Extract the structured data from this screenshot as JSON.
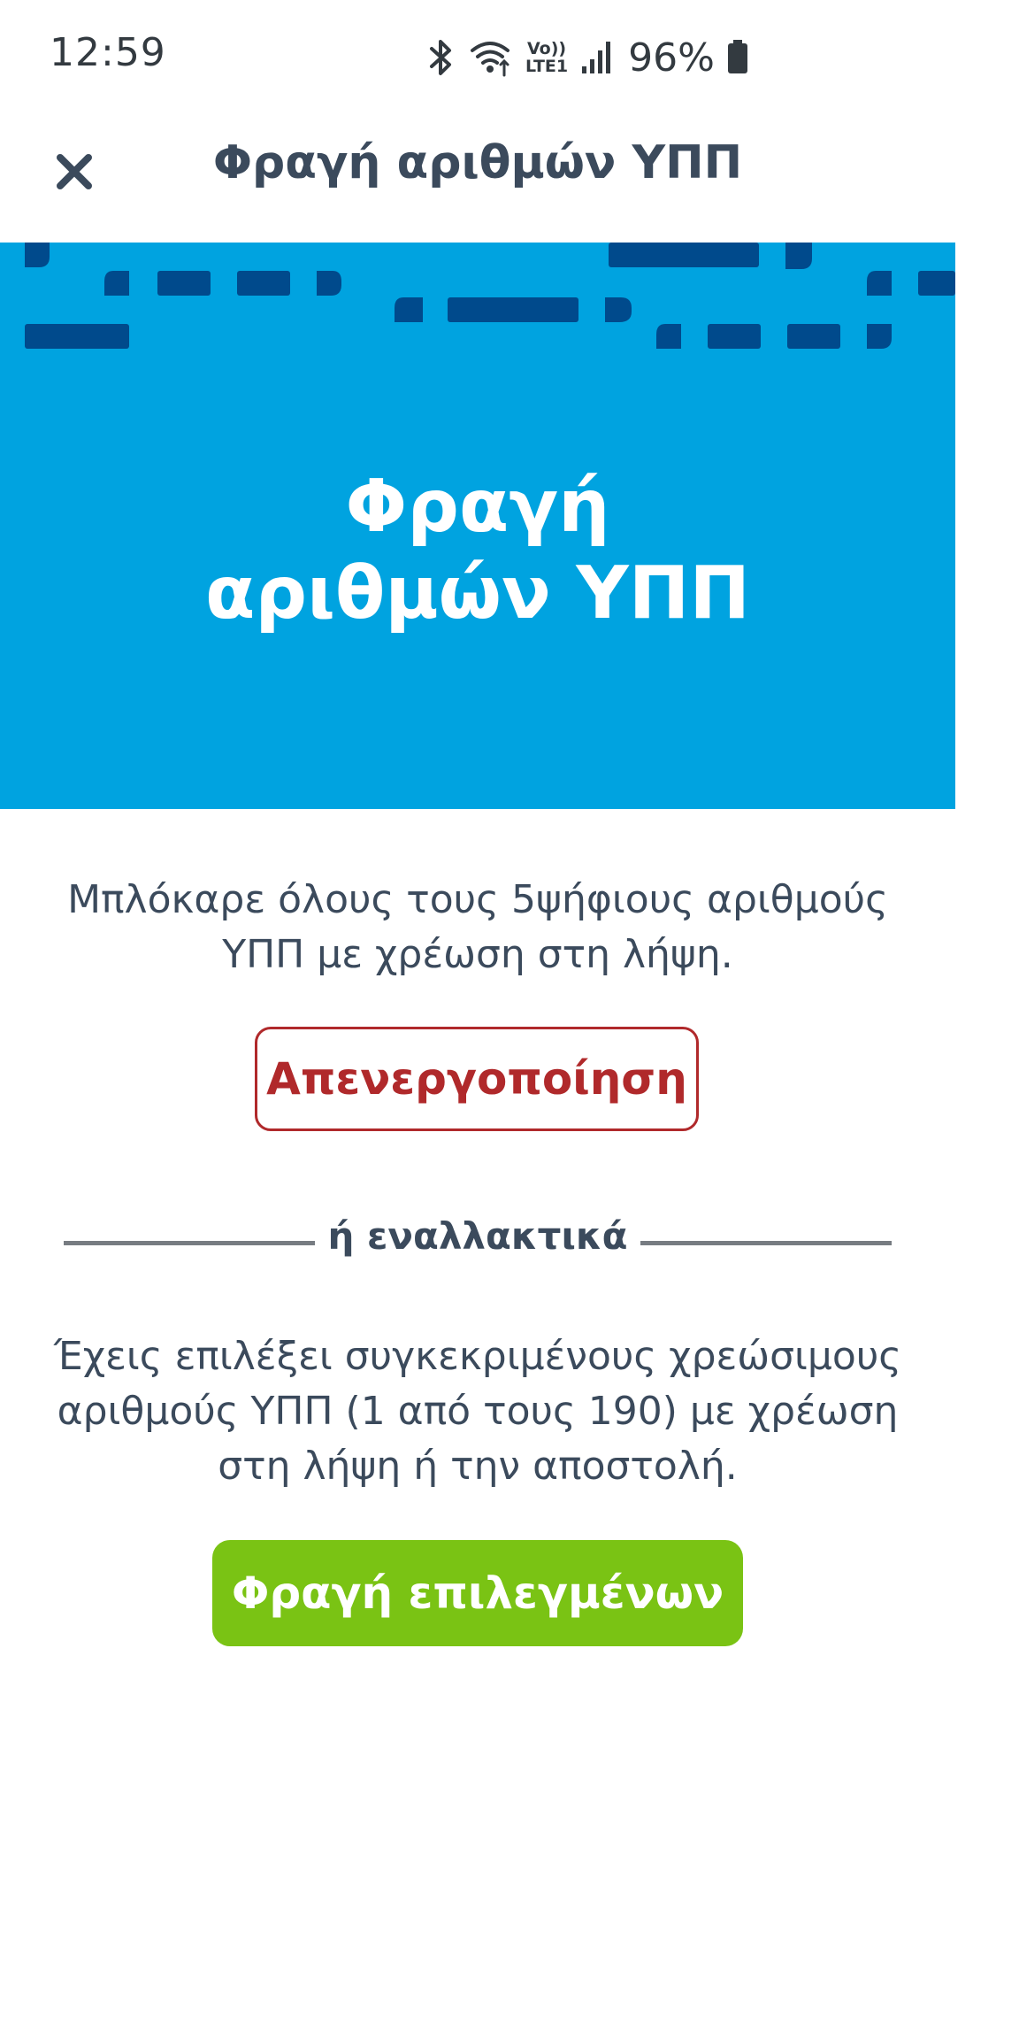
{
  "status_bar": {
    "time": "12:59",
    "battery": "96%",
    "icons": [
      "bluetooth-icon",
      "wifi-icon",
      "volte-icon",
      "signal-icon",
      "battery-icon"
    ],
    "volte_top": "Vo))",
    "volte_bottom": "LTE1"
  },
  "header": {
    "title": "Φραγή αριθμών ΥΠΠ",
    "close_icon": "close-icon"
  },
  "banner": {
    "title_line1": "Φραγή",
    "title_line2": "αριθμών ΥΠΠ",
    "background_color": "#00a3e0",
    "pattern_color": "#004a8c"
  },
  "section1": {
    "line1": "Μπλόκαρε όλους τους 5ψήφιους αριθμούς",
    "line2": "ΥΠΠ με χρέωση στη λήψη.",
    "button_label": "Απενεργοποίηση",
    "button_color": "#b0292b"
  },
  "divider": {
    "label": "ή εναλλακτικά"
  },
  "section2": {
    "line1": "Έχεις επιλέξει συγκεκριμένους χρεώσιμους",
    "line2": "αριθμούς ΥΠΠ (1 από τους 190) με χρέωση",
    "line3": "στη λήψη ή την αποστολή.",
    "button_label": "Φραγή επιλεγμένων",
    "button_color": "#7ac314"
  }
}
